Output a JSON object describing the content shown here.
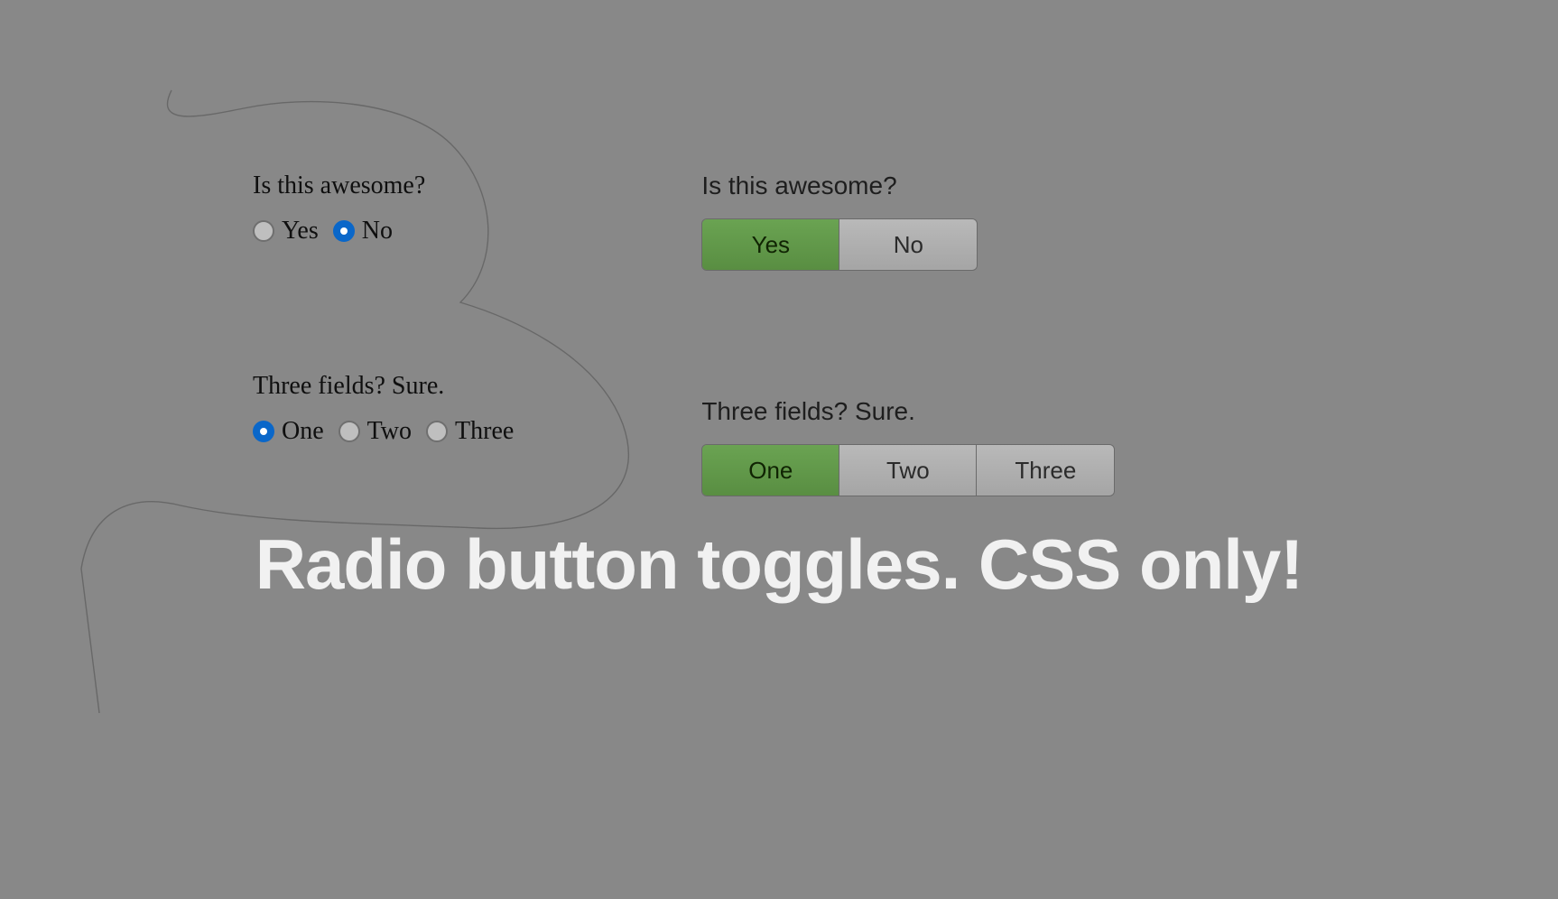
{
  "headline": "Radio button toggles. CSS only!",
  "left": {
    "group1": {
      "label": "Is this awesome?",
      "options": [
        {
          "label": "Yes",
          "selected": false
        },
        {
          "label": "No",
          "selected": true
        }
      ]
    },
    "group2": {
      "label": "Three fields? Sure.",
      "options": [
        {
          "label": "One",
          "selected": true
        },
        {
          "label": "Two",
          "selected": false
        },
        {
          "label": "Three",
          "selected": false
        }
      ]
    }
  },
  "right": {
    "group1": {
      "label": "Is this awesome?",
      "options": [
        {
          "label": "Yes",
          "selected": true
        },
        {
          "label": "No",
          "selected": false
        }
      ]
    },
    "group2": {
      "label": "Three fields? Sure.",
      "options": [
        {
          "label": "One",
          "selected": true
        },
        {
          "label": "Two",
          "selected": false
        },
        {
          "label": "Three",
          "selected": false
        }
      ]
    }
  },
  "colors": {
    "accent_blue": "#0a67c9",
    "accent_green": "#5f9947",
    "bg": "#888888"
  }
}
